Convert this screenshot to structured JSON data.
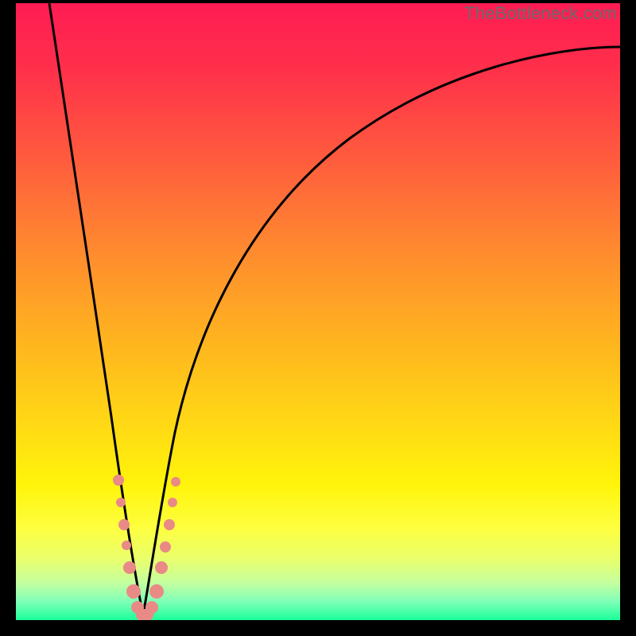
{
  "watermark": {
    "text": "TheBottleneck.com"
  },
  "chart_data": {
    "type": "line",
    "title": "",
    "xlabel": "",
    "ylabel": "",
    "xlim": [
      0,
      100
    ],
    "ylim": [
      0,
      100
    ],
    "optimum_x": 20,
    "series": [
      {
        "name": "bottleneck-curve",
        "x": [
          0,
          4,
          8,
          12,
          15,
          17,
          18,
          19,
          20,
          21,
          22,
          23,
          25,
          28,
          33,
          40,
          50,
          62,
          76,
          90,
          100
        ],
        "values": [
          100,
          78,
          58,
          40,
          25,
          14,
          9,
          3,
          0,
          3,
          9,
          14,
          22,
          33,
          44,
          56,
          68,
          77,
          83,
          87,
          89
        ]
      }
    ],
    "markers": {
      "name": "highlight-dots",
      "color": "#e98a86",
      "points": [
        {
          "x": 16.0,
          "y": 22,
          "r": 7
        },
        {
          "x": 16.4,
          "y": 18,
          "r": 6
        },
        {
          "x": 17.0,
          "y": 14,
          "r": 7
        },
        {
          "x": 17.4,
          "y": 11,
          "r": 6
        },
        {
          "x": 18.0,
          "y": 7,
          "r": 8
        },
        {
          "x": 18.7,
          "y": 3,
          "r": 9
        },
        {
          "x": 19.4,
          "y": 1,
          "r": 8
        },
        {
          "x": 20.2,
          "y": 0,
          "r": 9
        },
        {
          "x": 21.0,
          "y": 1,
          "r": 8
        },
        {
          "x": 21.8,
          "y": 3,
          "r": 9
        },
        {
          "x": 22.6,
          "y": 7,
          "r": 8
        },
        {
          "x": 23.2,
          "y": 11,
          "r": 7
        },
        {
          "x": 23.8,
          "y": 15,
          "r": 7
        },
        {
          "x": 24.4,
          "y": 19,
          "r": 6
        },
        {
          "x": 25.0,
          "y": 22,
          "r": 6
        }
      ]
    }
  }
}
